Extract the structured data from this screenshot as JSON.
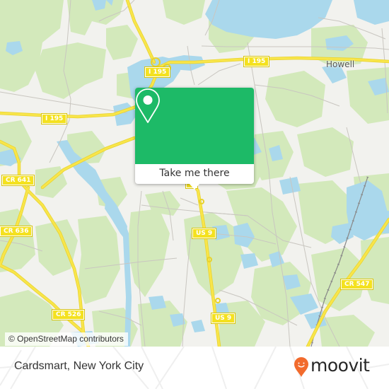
{
  "map": {
    "colors": {
      "land": "#f2f2ee",
      "forest": "#d3e9bb",
      "water": "#aad8ec",
      "highway": "#f4e11f",
      "minor_road": "#c9c6c0",
      "rail": "#777777"
    },
    "road_shields": [
      {
        "id": "i195-west",
        "label": "I 195"
      },
      {
        "id": "i195-center",
        "label": "I 195"
      },
      {
        "id": "i195-east",
        "label": "I 195"
      },
      {
        "id": "cr641",
        "label": "CR 641"
      },
      {
        "id": "cr636",
        "label": "CR 636"
      },
      {
        "id": "cr526",
        "label": "CR 526"
      },
      {
        "id": "us9-north",
        "label": "US 9"
      },
      {
        "id": "us9-south",
        "label": "US 9"
      },
      {
        "id": "cr547",
        "label": "CR 547"
      }
    ],
    "place_labels": [
      {
        "id": "howell",
        "label": "Howell"
      }
    ],
    "attribution": "© OpenStreetMap contributors"
  },
  "popup": {
    "icon": "map-pin-icon",
    "button_label": "Take me there",
    "accent_color": "#1dba67"
  },
  "footer": {
    "place_name": "Cardsmart, New York City",
    "brand": {
      "name": "moovit",
      "logo_icon": "moovit-pin-smile-icon",
      "logo_color": "#f26b2d"
    }
  }
}
